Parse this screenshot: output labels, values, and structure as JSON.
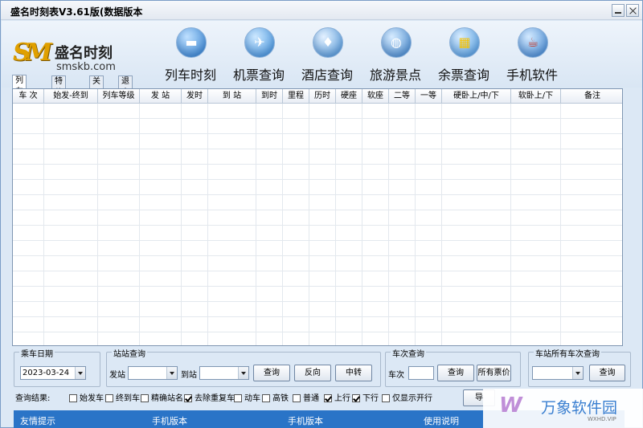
{
  "window": {
    "title": "盛名时刻表V3.61版(数据版本"
  },
  "logo": {
    "mark": "SM",
    "name": "盛名时刻",
    "domain": "smskb.com"
  },
  "nav": [
    {
      "label": "列车时刻",
      "icon": "train-icon",
      "color": "#2c7fd0"
    },
    {
      "label": "机票查询",
      "icon": "airplane-icon",
      "color": "#3a8fdc"
    },
    {
      "label": "酒店查询",
      "icon": "hotel-icon",
      "color": "#4a95d8"
    },
    {
      "label": "旅游景点",
      "icon": "globe-icon",
      "color": "#3f86cc"
    },
    {
      "label": "余票查询",
      "icon": "windows-icon",
      "color": "#4b9be0"
    },
    {
      "label": "手机软件",
      "icon": "java-icon",
      "color": "#3b84cf"
    }
  ],
  "tabs": [
    "列车时刻",
    "特价机票",
    "关于",
    "退出"
  ],
  "table": {
    "columns": [
      "车 次",
      "始发-终到",
      "列车等级",
      "发 站",
      "发时",
      "到 站",
      "到时",
      "里程",
      "历时",
      "硬座",
      "软座",
      "二等",
      "一等",
      "硬卧上/中/下",
      "软卧上/下",
      "备注"
    ],
    "rows": []
  },
  "ride_date": {
    "title": "乘车日期",
    "value": "2023-03-24"
  },
  "station_query": {
    "title": "站站查询",
    "from_label": "发站",
    "to_label": "到站",
    "query_btn": "查询",
    "reverse_btn": "反向",
    "transfer_btn": "中转"
  },
  "train_query": {
    "title": "车次查询",
    "train_label": "车次",
    "query_btn": "查询",
    "all_prices_btn": "所有票价"
  },
  "station_trains": {
    "title": "车站所有车次查询",
    "query_btn": "查询"
  },
  "results": {
    "label": "查询结果:",
    "options": [
      {
        "label": "始发车",
        "checked": false
      },
      {
        "label": "终到车",
        "checked": false
      },
      {
        "label": "精确站名",
        "checked": false
      },
      {
        "label": "去除重复车",
        "checked": true
      },
      {
        "label": "动车",
        "checked": false
      },
      {
        "label": "高铁",
        "checked": false
      },
      {
        "label": "普通",
        "checked": false
      },
      {
        "label": "上行",
        "checked": true
      },
      {
        "label": "下行",
        "checked": true
      },
      {
        "label": "仅显示开行",
        "checked": false
      }
    ],
    "partial_btn": "导"
  },
  "statusbar": {
    "items": [
      "友情提示",
      "手机版本",
      "手机版本",
      "使用说明"
    ]
  },
  "watermark": {
    "logo": "W",
    "name": "万象软件园",
    "sub": "WXHD.VIP"
  }
}
